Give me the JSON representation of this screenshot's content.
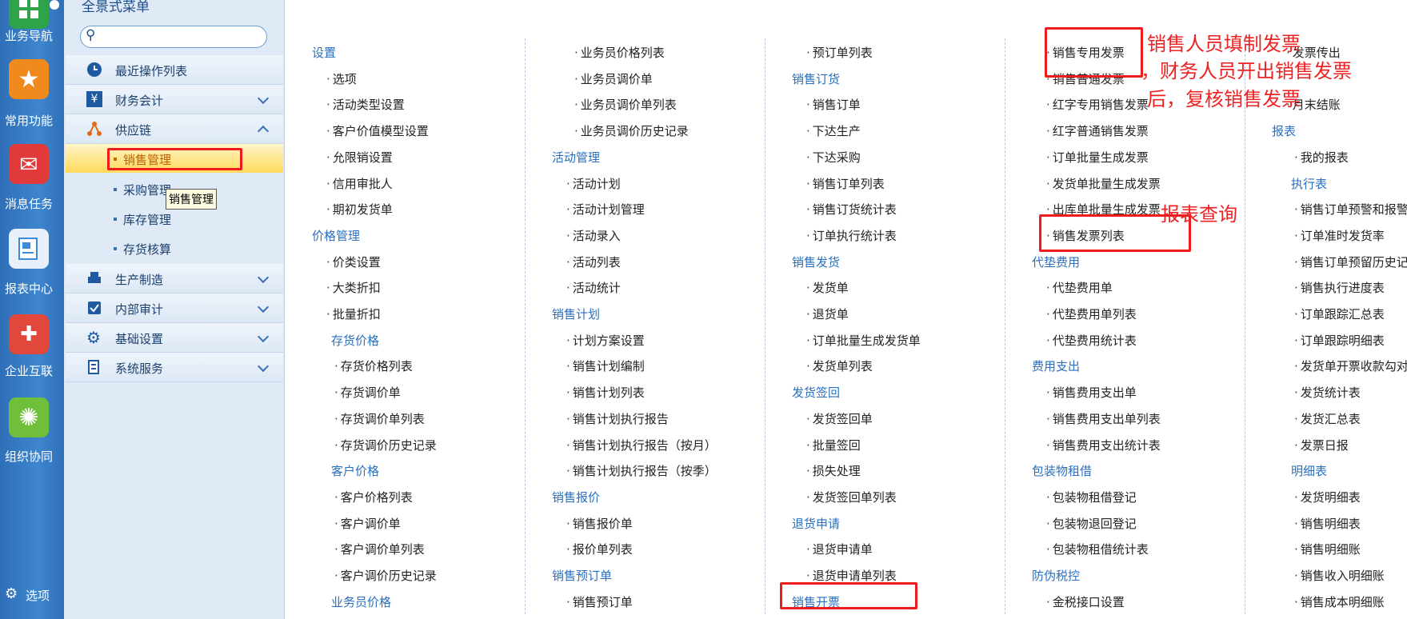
{
  "rail": [
    {
      "name": "business-nav",
      "label": "业务导航",
      "color": "#2fa34a"
    },
    {
      "name": "common-functions",
      "label": "常用功能",
      "color": "#f08a1c"
    },
    {
      "name": "message-tasks",
      "label": "消息任务",
      "color": "#e23a3a"
    },
    {
      "name": "report-center",
      "label": "报表中心",
      "color": "#3c8ad8"
    },
    {
      "name": "enterprise-interconnect",
      "label": "企业互联",
      "color": "#e2473c"
    },
    {
      "name": "org-collaboration",
      "label": "组织协同",
      "color": "#6fbf3a"
    }
  ],
  "rail_options": "选项",
  "tree": {
    "title": "全景式菜单",
    "search_placeholder": "",
    "recent": "最近操作列表",
    "finance": "财务会计",
    "supply": "供应链",
    "supply_children": [
      "销售管理",
      "采购管理",
      "库存管理",
      "存货核算"
    ],
    "production": "生产制造",
    "audit": "内部审计",
    "basic": "基础设置",
    "system": "系统服务",
    "tooltip": "销售管理"
  },
  "columns": [
    [
      {
        "t": "h",
        "v": "设置"
      },
      {
        "t": "s",
        "v": "选项"
      },
      {
        "t": "s",
        "v": "活动类型设置"
      },
      {
        "t": "s",
        "v": "客户价值模型设置"
      },
      {
        "t": "s",
        "v": "允限销设置"
      },
      {
        "t": "s",
        "v": "信用审批人"
      },
      {
        "t": "s",
        "v": "期初发货单"
      },
      {
        "t": "h",
        "v": "价格管理"
      },
      {
        "t": "s",
        "v": "价类设置"
      },
      {
        "t": "s",
        "v": "大类折扣"
      },
      {
        "t": "s",
        "v": "批量折扣"
      },
      {
        "t": "h2",
        "v": "存货价格"
      },
      {
        "t": "s2",
        "v": "存货价格列表"
      },
      {
        "t": "s2",
        "v": "存货调价单"
      },
      {
        "t": "s2",
        "v": "存货调价单列表"
      },
      {
        "t": "s2",
        "v": "存货调价历史记录"
      },
      {
        "t": "h2",
        "v": "客户价格"
      },
      {
        "t": "s2",
        "v": "客户价格列表"
      },
      {
        "t": "s2",
        "v": "客户调价单"
      },
      {
        "t": "s2",
        "v": "客户调价单列表"
      },
      {
        "t": "s2",
        "v": "客户调价历史记录"
      },
      {
        "t": "h2",
        "v": "业务员价格"
      }
    ],
    [
      {
        "t": "s2",
        "v": "业务员价格列表"
      },
      {
        "t": "s2",
        "v": "业务员调价单"
      },
      {
        "t": "s2",
        "v": "业务员调价单列表"
      },
      {
        "t": "s2",
        "v": "业务员调价历史记录"
      },
      {
        "t": "h",
        "v": "活动管理"
      },
      {
        "t": "s",
        "v": "活动计划"
      },
      {
        "t": "s",
        "v": "活动计划管理"
      },
      {
        "t": "s",
        "v": "活动录入"
      },
      {
        "t": "s",
        "v": "活动列表"
      },
      {
        "t": "s",
        "v": "活动统计"
      },
      {
        "t": "h",
        "v": "销售计划"
      },
      {
        "t": "s",
        "v": "计划方案设置"
      },
      {
        "t": "s",
        "v": "销售计划编制"
      },
      {
        "t": "s",
        "v": "销售计划列表"
      },
      {
        "t": "s",
        "v": "销售计划执行报告"
      },
      {
        "t": "s",
        "v": "销售计划执行报告（按月）"
      },
      {
        "t": "s",
        "v": "销售计划执行报告（按季）"
      },
      {
        "t": "h",
        "v": "销售报价"
      },
      {
        "t": "s",
        "v": "销售报价单"
      },
      {
        "t": "s",
        "v": "报价单列表"
      },
      {
        "t": "h",
        "v": "销售预订单"
      },
      {
        "t": "s",
        "v": "销售预订单"
      }
    ],
    [
      {
        "t": "s",
        "v": "预订单列表"
      },
      {
        "t": "h",
        "v": "销售订货"
      },
      {
        "t": "s",
        "v": "销售订单"
      },
      {
        "t": "s",
        "v": "下达生产"
      },
      {
        "t": "s",
        "v": "下达采购"
      },
      {
        "t": "s",
        "v": "销售订单列表"
      },
      {
        "t": "s",
        "v": "销售订货统计表"
      },
      {
        "t": "s",
        "v": "订单执行统计表"
      },
      {
        "t": "h",
        "v": "销售发货"
      },
      {
        "t": "s",
        "v": "发货单"
      },
      {
        "t": "s",
        "v": "退货单"
      },
      {
        "t": "s",
        "v": "订单批量生成发货单"
      },
      {
        "t": "s",
        "v": "发货单列表"
      },
      {
        "t": "h",
        "v": "发货签回"
      },
      {
        "t": "s",
        "v": "发货签回单"
      },
      {
        "t": "s",
        "v": "批量签回"
      },
      {
        "t": "s",
        "v": "损失处理"
      },
      {
        "t": "s",
        "v": "发货签回单列表"
      },
      {
        "t": "h",
        "v": "退货申请"
      },
      {
        "t": "s",
        "v": "退货申请单"
      },
      {
        "t": "s",
        "v": "退货申请单列表"
      },
      {
        "t": "h",
        "v": "销售开票"
      }
    ],
    [
      {
        "t": "s",
        "v": "销售专用发票"
      },
      {
        "t": "s",
        "v": "销售普通发票"
      },
      {
        "t": "s",
        "v": "红字专用销售发票"
      },
      {
        "t": "s",
        "v": "红字普通销售发票"
      },
      {
        "t": "s",
        "v": "订单批量生成发票"
      },
      {
        "t": "s",
        "v": "发货单批量生成发票"
      },
      {
        "t": "s",
        "v": "出库单批量生成发票"
      },
      {
        "t": "s",
        "v": "销售发票列表"
      },
      {
        "t": "h",
        "v": "代垫费用"
      },
      {
        "t": "s",
        "v": "代垫费用单"
      },
      {
        "t": "s",
        "v": "代垫费用单列表"
      },
      {
        "t": "s",
        "v": "代垫费用统计表"
      },
      {
        "t": "h",
        "v": "费用支出"
      },
      {
        "t": "s",
        "v": "销售费用支出单"
      },
      {
        "t": "s",
        "v": "销售费用支出单列表"
      },
      {
        "t": "s",
        "v": "销售费用支出统计表"
      },
      {
        "t": "h",
        "v": "包装物租借"
      },
      {
        "t": "s",
        "v": "包装物租借登记"
      },
      {
        "t": "s",
        "v": "包装物退回登记"
      },
      {
        "t": "s",
        "v": "包装物租借统计表"
      },
      {
        "t": "h",
        "v": "防伪税控"
      },
      {
        "t": "s",
        "v": "金税接口设置"
      }
    ],
    [
      {
        "t": "s",
        "v": "发票传出"
      },
      {
        "t": "s",
        "v": ""
      },
      {
        "t": "s",
        "v": "月末结账"
      },
      {
        "t": "h",
        "v": "报表"
      },
      {
        "t": "s2",
        "v": "我的报表"
      },
      {
        "t": "h2",
        "v": "执行表"
      },
      {
        "t": "s2",
        "v": "销售订单预警和报警"
      },
      {
        "t": "s2",
        "v": "订单准时发货率"
      },
      {
        "t": "s2",
        "v": "销售订单预留历史记录"
      },
      {
        "t": "s2",
        "v": "销售执行进度表"
      },
      {
        "t": "s2",
        "v": "订单跟踪汇总表"
      },
      {
        "t": "s2",
        "v": "订单跟踪明细表"
      },
      {
        "t": "s2",
        "v": "发货单开票收款勾对表"
      },
      {
        "t": "s2",
        "v": "发货统计表"
      },
      {
        "t": "s2",
        "v": "发货汇总表"
      },
      {
        "t": "s2",
        "v": "发票日报"
      },
      {
        "t": "h2",
        "v": "明细表"
      },
      {
        "t": "s2",
        "v": "发货明细表"
      },
      {
        "t": "s2",
        "v": "销售明细表"
      },
      {
        "t": "s2",
        "v": "销售明细账"
      },
      {
        "t": "s2",
        "v": "销售收入明细账"
      },
      {
        "t": "s2",
        "v": "销售成本明细账"
      }
    ]
  ],
  "annotations": {
    "note1_line1": "销售人员填制发票",
    "note1_line2": "，财务人员开出销售发票",
    "note1_line3": "后，复核销售发票",
    "note2": "报表查询"
  },
  "colors": {
    "accent": "#2a6fc0",
    "annotation": "#ee1c1c",
    "rail": "#3d86cf"
  }
}
